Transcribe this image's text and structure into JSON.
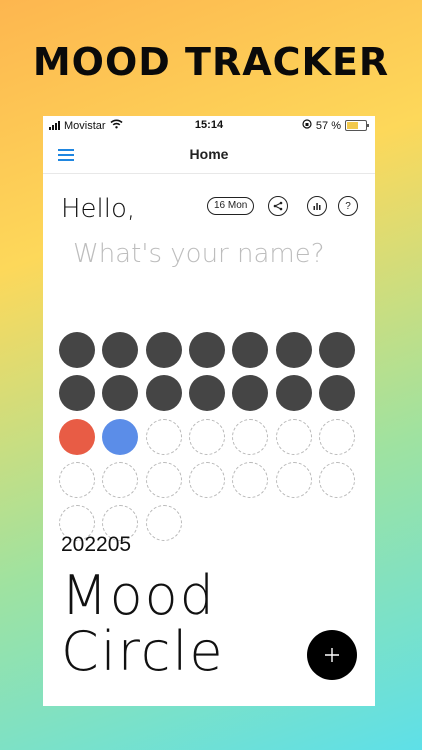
{
  "banner": "MOOD TRACKER",
  "status_bar": {
    "carrier": "Movistar",
    "time": "15:14",
    "battery": "57 %"
  },
  "nav": {
    "title": "Home"
  },
  "greeting": "Hello,",
  "date_pill": "16 Mon",
  "name_placeholder": "What's your name?",
  "mood_grid": {
    "colors": {
      "filled": "#454545",
      "red": "#e85c45",
      "blue": "#5b8de8"
    },
    "cells": [
      "filled",
      "filled",
      "filled",
      "filled",
      "filled",
      "filled",
      "filled",
      "filled",
      "filled",
      "filled",
      "filled",
      "filled",
      "filled",
      "filled",
      "red",
      "blue",
      "empty",
      "empty",
      "empty",
      "empty",
      "empty",
      "empty",
      "empty",
      "empty",
      "empty",
      "empty",
      "empty",
      "empty",
      "empty",
      "empty",
      "empty"
    ]
  },
  "period": "202205",
  "app_title": {
    "line1": "Mood",
    "line2": "Circle"
  },
  "icons": {
    "menu": "hamburger-icon",
    "share": "share-icon",
    "stats": "bar-chart-icon",
    "help": "help-icon",
    "add": "plus-icon"
  }
}
